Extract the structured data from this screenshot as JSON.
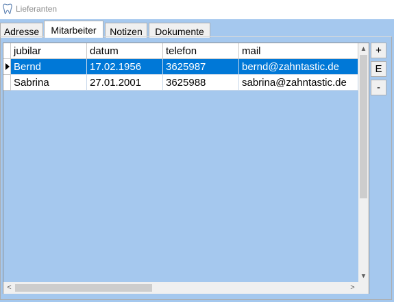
{
  "window": {
    "title": "Lieferanten",
    "icon": "tooth-icon"
  },
  "tabs": [
    {
      "label": "Adresse",
      "active": false
    },
    {
      "label": "Mitarbeiter",
      "active": true
    },
    {
      "label": "Notizen",
      "active": false
    },
    {
      "label": "Dokumente",
      "active": false
    }
  ],
  "grid": {
    "columns": [
      "jubilar",
      "datum",
      "telefon",
      "mail"
    ],
    "rows": [
      {
        "jubilar": "Bernd",
        "datum": "17.02.1956",
        "telefon": "3625987",
        "mail": "bernd@zahntastic.de",
        "selected": true
      },
      {
        "jubilar": "Sabrina",
        "datum": "27.01.2001",
        "telefon": "3625988",
        "mail": "sabrina@zahntastic.de",
        "selected": false
      }
    ],
    "selection_color": "#0078d7",
    "background_color": "#a5c8ee"
  },
  "buttons": {
    "add": "+",
    "edit": "E",
    "remove": "-"
  }
}
